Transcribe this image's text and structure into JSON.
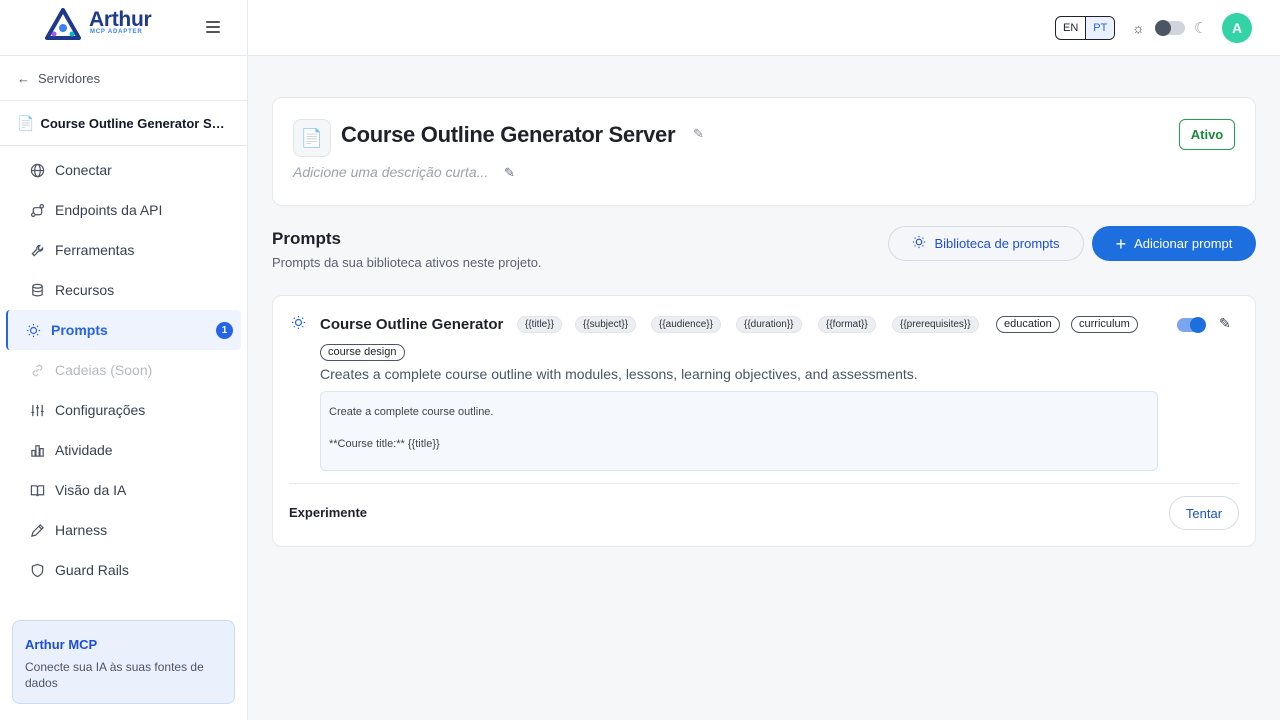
{
  "brand": {
    "name": "Arthur",
    "subtitle": "MCP ADAPTER",
    "logo_icon": "arthur-logo-icon"
  },
  "sidebar": {
    "back_label": "Servidores",
    "server_name": "Course Outline Generator Server",
    "items": [
      {
        "label": "Conectar",
        "icon": "globe-icon"
      },
      {
        "label": "Endpoints da API",
        "icon": "route-icon"
      },
      {
        "label": "Ferramentas",
        "icon": "wrench-icon"
      },
      {
        "label": "Recursos",
        "icon": "database-icon"
      },
      {
        "label": "Prompts",
        "icon": "lightbulb-icon",
        "badge": "1",
        "active": true
      },
      {
        "label": "Cadeias (Soon)",
        "icon": "link-icon",
        "disabled": true
      },
      {
        "label": "Configurações",
        "icon": "sliders-icon"
      },
      {
        "label": "Atividade",
        "icon": "bar-chart-icon"
      },
      {
        "label": "Visão da IA",
        "icon": "book-icon"
      },
      {
        "label": "Harness",
        "icon": "pen-icon"
      },
      {
        "label": "Guard Rails",
        "icon": "shield-icon"
      }
    ],
    "promo": {
      "title": "Arthur MCP",
      "text": "Conecte sua IA às suas fontes de dados"
    }
  },
  "topbar": {
    "lang_en": "EN",
    "lang_pt": "PT",
    "avatar_letter": "A"
  },
  "header": {
    "title": "Course Outline Generator Server",
    "description_placeholder": "Adicione uma descrição curta...",
    "status": "Ativo"
  },
  "prompts_section": {
    "title": "Prompts",
    "subtitle": "Prompts da sua biblioteca ativos neste projeto.",
    "library_button": "Biblioteca de prompts",
    "add_button": "Adicionar prompt"
  },
  "prompt": {
    "name": "Course Outline Generator",
    "variables": [
      "{{title}}",
      "{{subject}}",
      "{{audience}}",
      "{{duration}}",
      "{{format}}",
      "{{prerequisites}}"
    ],
    "tags": [
      "education",
      "curriculum",
      "course design"
    ],
    "description": "Creates a complete course outline with modules, lessons, learning objectives, and assessments.",
    "body_lines": [
      "Create a complete course outline.",
      "",
      "**Course title:** {{title}}"
    ],
    "enabled": true,
    "try_label": "Experimente",
    "try_button": "Tentar"
  },
  "colors": {
    "accent": "#1d6fe0",
    "status_green": "#22a24a",
    "avatar": "#34d3a6"
  }
}
